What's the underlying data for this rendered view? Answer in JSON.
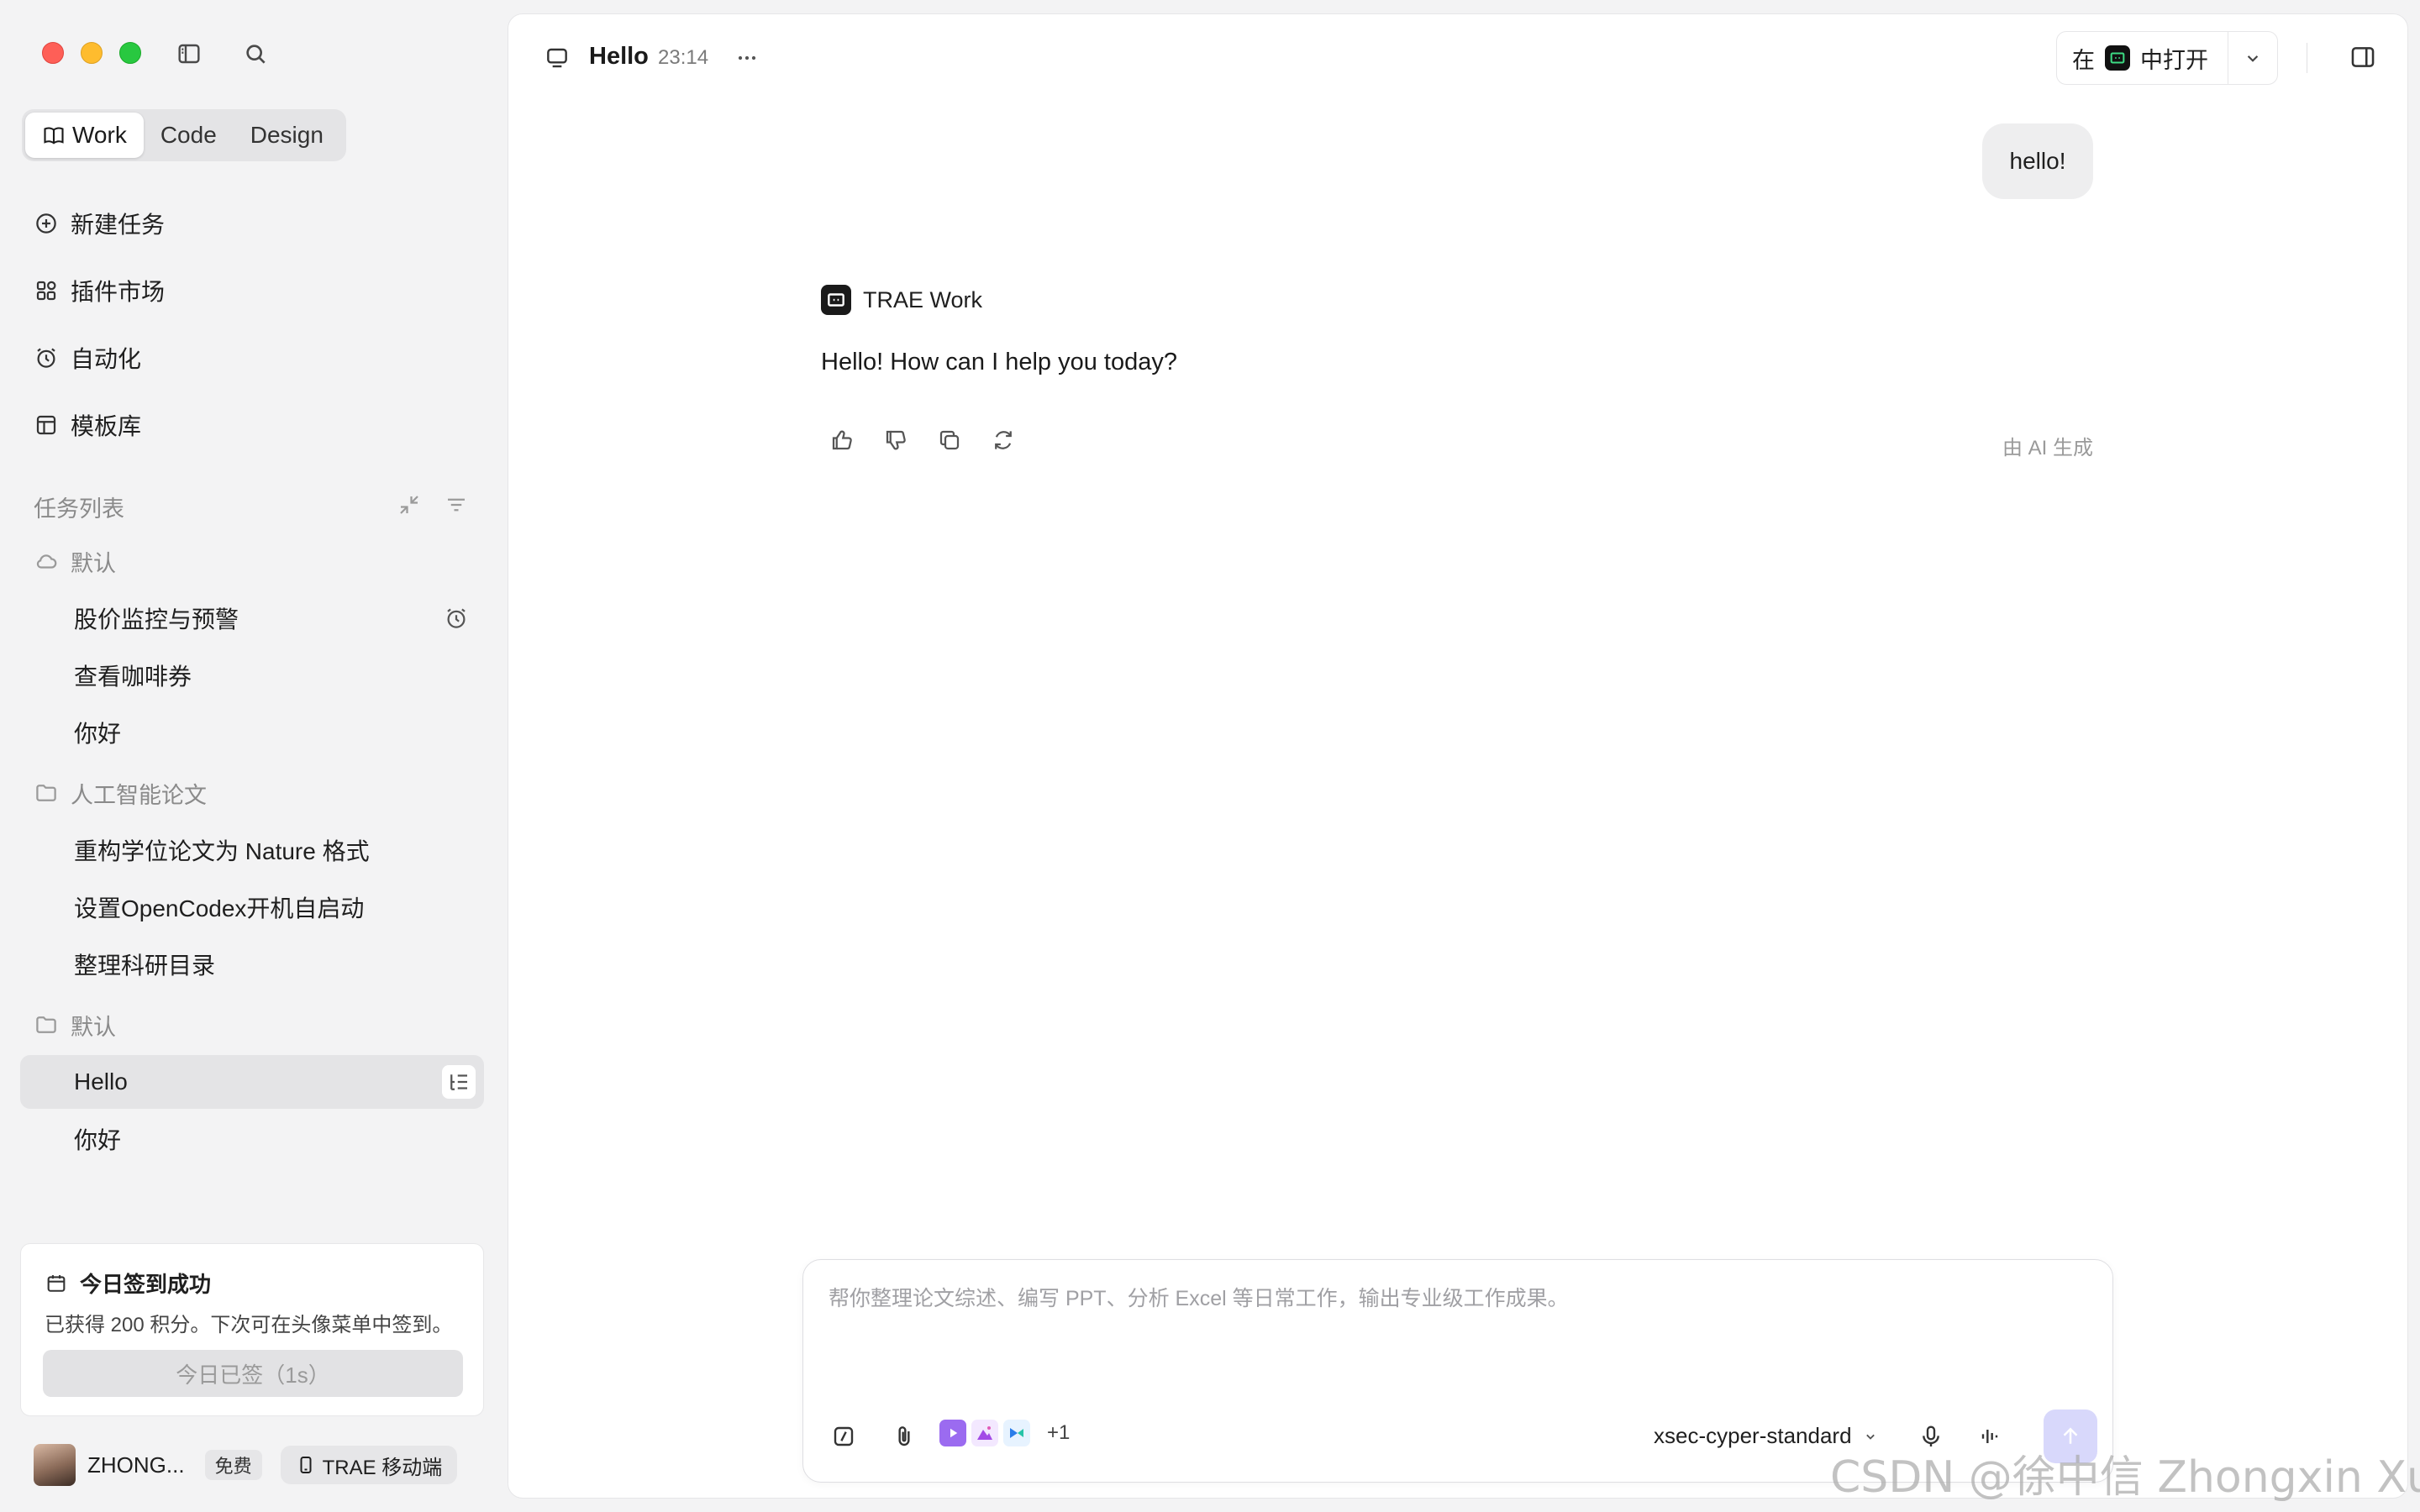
{
  "sidebar": {
    "modes": [
      {
        "label": "Work",
        "icon": "book-icon",
        "active": true
      },
      {
        "label": "Code",
        "active": false
      },
      {
        "label": "Design",
        "active": false
      }
    ],
    "nav": [
      {
        "label": "新建任务",
        "icon": "plus-circle-icon"
      },
      {
        "label": "插件市场",
        "icon": "apps-icon"
      },
      {
        "label": "自动化",
        "icon": "alarm-clock-icon"
      },
      {
        "label": "模板库",
        "icon": "template-icon"
      }
    ],
    "section_title": "任务列表",
    "groups": [
      {
        "label": "默认",
        "icon": "cloud-icon",
        "tasks": [
          "股价监控与预警",
          "查看咖啡券",
          "你好"
        ]
      },
      {
        "label": "人工智能论文",
        "icon": "folder-icon",
        "tasks": [
          "重构学位论文为 Nature 格式",
          "设置OpenCodex开机自启动",
          "整理科研目录"
        ]
      },
      {
        "label": "默认",
        "icon": "folder-icon",
        "tasks": [
          "Hello",
          "你好"
        ]
      }
    ],
    "checkin": {
      "title": "今日签到成功",
      "desc": "已获得 200 积分。下次可在头像菜单中签到。",
      "button": "今日已签（1s）"
    },
    "user": {
      "name": "ZHONG...",
      "plan": "免费",
      "mobile": "TRAE 移动端"
    }
  },
  "header": {
    "title": "Hello",
    "time": "23:14",
    "open_in_prefix": "在",
    "open_in_suffix": "中打开"
  },
  "chat": {
    "user_message": "hello!",
    "assistant_name": "TRAE Work",
    "assistant_message": "Hello! How can I help you today?",
    "ai_generated": "由 AI 生成"
  },
  "composer": {
    "placeholder": "帮你整理论文综述、编写 PPT、分析 Excel 等日常工作，输出专业级工作成果。",
    "plugin_extra": "+1",
    "model": "xsec-cyper-standard"
  },
  "watermark": "CSDN @徐中信 Zhongxin Xu",
  "colors": {
    "accent_send": "#d8d8fb",
    "active_item_bg": "#e4e4e6",
    "traffic_red": "#fe5f57",
    "traffic_yellow": "#febc2e",
    "traffic_green": "#28c840"
  }
}
